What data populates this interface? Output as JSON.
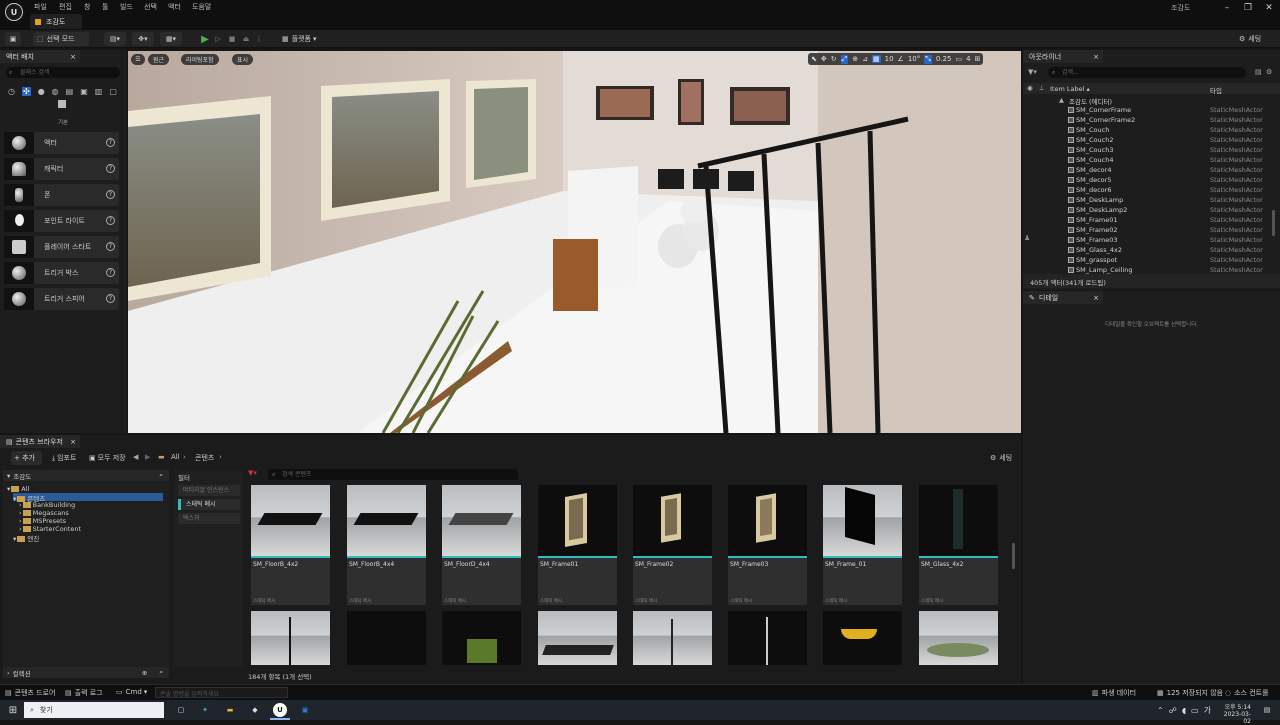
{
  "titlebar": {
    "menu": [
      "파일",
      "편집",
      "창",
      "툴",
      "빌드",
      "선택",
      "액터",
      "도움말"
    ],
    "project": "조감도",
    "map_tab": "조감도"
  },
  "toolbar": {
    "save_icon": "save-icon",
    "mode": "선택 모드",
    "platform": "플랫폼",
    "settings": "세팅"
  },
  "place_actors": {
    "tab": "액터 배치",
    "search_placeholder": "클래스 검색",
    "category": "기본",
    "items": [
      {
        "label": "액터"
      },
      {
        "label": "캐릭터"
      },
      {
        "label": "폰"
      },
      {
        "label": "포인트 라이트"
      },
      {
        "label": "플레이어 스타트"
      },
      {
        "label": "트리거 박스"
      },
      {
        "label": "트리거 스피어"
      }
    ]
  },
  "viewport": {
    "perspective": "원근",
    "lit": "라이팅포함",
    "show": "표시",
    "grid_snap": "10",
    "rot_snap": "10°",
    "scale_snap": "0.25",
    "cam_speed": "4"
  },
  "outliner": {
    "tab": "아웃라이너",
    "search_placeholder": "검색...",
    "col_label": "Item Label",
    "col_type": "타입",
    "root": "조감도 (에디터)",
    "rows": [
      {
        "name": "SM_CornerFrame",
        "type": "StaticMeshActor"
      },
      {
        "name": "SM_CornerFrame2",
        "type": "StaticMeshActor"
      },
      {
        "name": "SM_Couch",
        "type": "StaticMeshActor"
      },
      {
        "name": "SM_Couch2",
        "type": "StaticMeshActor"
      },
      {
        "name": "SM_Couch3",
        "type": "StaticMeshActor"
      },
      {
        "name": "SM_Couch4",
        "type": "StaticMeshActor"
      },
      {
        "name": "SM_decor4",
        "type": "StaticMeshActor"
      },
      {
        "name": "SM_decor5",
        "type": "StaticMeshActor"
      },
      {
        "name": "SM_decor6",
        "type": "StaticMeshActor"
      },
      {
        "name": "SM_DeskLamp",
        "type": "StaticMeshActor"
      },
      {
        "name": "SM_DeskLamp2",
        "type": "StaticMeshActor"
      },
      {
        "name": "SM_Frame01",
        "type": "StaticMeshActor"
      },
      {
        "name": "SM_Frame02",
        "type": "StaticMeshActor"
      },
      {
        "name": "SM_Frame03",
        "type": "StaticMeshActor"
      },
      {
        "name": "SM_Glass_4x2",
        "type": "StaticMeshActor"
      },
      {
        "name": "SM_grasspot",
        "type": "StaticMeshActor"
      },
      {
        "name": "SM_Lamp_Ceiling",
        "type": "StaticMeshActor"
      }
    ],
    "count": "405개 액터(341개 로드됨)"
  },
  "details": {
    "tab": "디테일",
    "empty": "디테일을 확인할 오브젝트를 선택합니다."
  },
  "content_browser": {
    "tab": "콘텐츠 브라우저",
    "add": "+ 추가",
    "import": "임포트",
    "save_all": "모두 저장",
    "path_root": "All",
    "path_content": "콘텐츠",
    "settings": "세팅",
    "tree_header": "조감도",
    "tree": [
      {
        "label": "All",
        "depth": 0
      },
      {
        "label": "콘텐츠",
        "depth": 1
      },
      {
        "label": "BankBuilding",
        "depth": 2
      },
      {
        "label": "Megascans",
        "depth": 2
      },
      {
        "label": "MSPresets",
        "depth": 2
      },
      {
        "label": "StarterContent",
        "depth": 2
      },
      {
        "label": "엔진",
        "depth": 1
      }
    ],
    "collections": "컬렉션",
    "filter_header": "필터",
    "filters": [
      "머티리얼 인스턴스",
      "스태틱 메시",
      "텍스처"
    ],
    "search_placeholder": "검색 콘텐츠",
    "assets": [
      {
        "name": "SM_FloorB_4x2",
        "type": "스태틱 메시"
      },
      {
        "name": "SM_FloorB_4x4",
        "type": "스태틱 메시"
      },
      {
        "name": "SM_FloorD_4x4",
        "type": "스태틱 메시"
      },
      {
        "name": "SM_Frame01",
        "type": "스태틱 메시"
      },
      {
        "name": "SM_Frame02",
        "type": "스태틱 메시"
      },
      {
        "name": "SM_Frame03",
        "type": "스태틱 메시"
      },
      {
        "name": "SM_Frame_01",
        "type": "스태틱 메시"
      },
      {
        "name": "SM_Glass_4x2",
        "type": "스태틱 메시"
      }
    ],
    "item_count": "184개 항목 (1개 선택)"
  },
  "statusbar": {
    "drawer": "콘텐츠 드로어",
    "output": "출력 로그",
    "cmd": "Cmd",
    "console_placeholder": "콘솔 명령을 입력하세요",
    "derived": "파생 데이터",
    "unsaved": "125 저장되지 않음",
    "source": "소스 컨트롤"
  },
  "taskbar": {
    "search": "찾기",
    "time": "오후 5:14",
    "date": "2023-03-02"
  }
}
